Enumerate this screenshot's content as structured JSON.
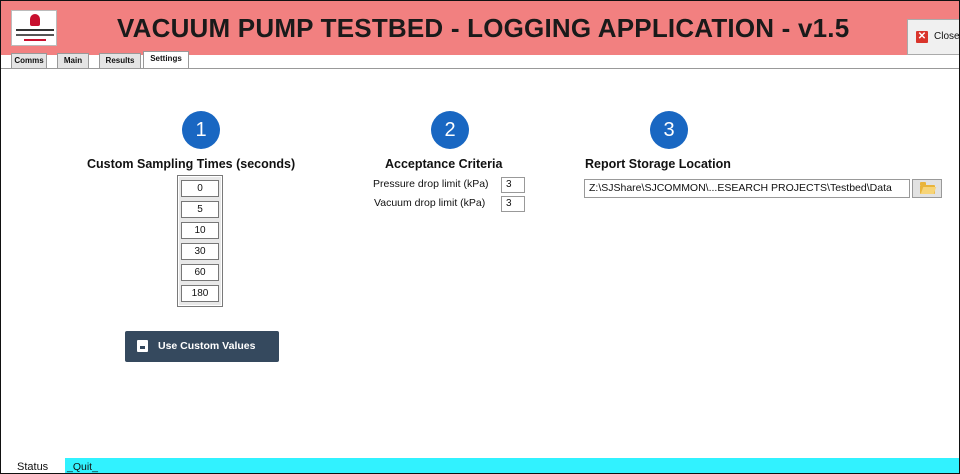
{
  "app": {
    "title": "VACUUM PUMP TESTBED - LOGGING APPLICATION - v1.5",
    "close_label": "Close"
  },
  "tabs": [
    {
      "label": "Comms",
      "active": false
    },
    {
      "label": "Main",
      "active": false
    },
    {
      "label": "Results",
      "active": false
    },
    {
      "label": "Settings",
      "active": true
    }
  ],
  "sections": {
    "sampling": {
      "step": "1",
      "heading": "Custom Sampling Times (seconds)",
      "times": [
        "0",
        "5",
        "10",
        "30",
        "60",
        "180"
      ],
      "button_label": "Use Custom Values"
    },
    "acceptance": {
      "step": "2",
      "heading": "Acceptance Criteria",
      "pressure_label": "Pressure drop limit (kPa)",
      "pressure_value": "3",
      "vacuum_label": "Vacuum drop limit (kPa)",
      "vacuum_value": "3"
    },
    "storage": {
      "step": "3",
      "heading": "Report Storage Location",
      "path": "Z:\\SJShare\\SJCOMMON\\...ESEARCH PROJECTS\\Testbed\\Data"
    }
  },
  "status": {
    "label": "Status",
    "message": "_Quit_"
  },
  "icons": {
    "close": "close-icon",
    "save": "save-icon",
    "folder": "folder-open-icon",
    "logo": "hospital-logo"
  },
  "colors": {
    "header": "#f28080",
    "step_circle": "#1967c2",
    "button": "#35495e",
    "status_bar": "#31f2ff"
  }
}
